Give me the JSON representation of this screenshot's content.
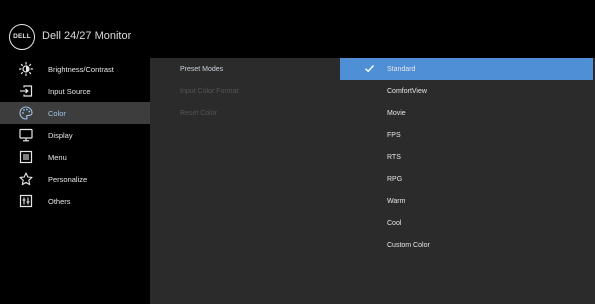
{
  "brand": {
    "logo_text": "DELL",
    "title": "Dell 24/27 Monitor"
  },
  "menu": {
    "items": [
      {
        "label": "Brightness/Contrast",
        "icon": "brightness-icon",
        "active": false
      },
      {
        "label": "Input Source",
        "icon": "input-source-icon",
        "active": false
      },
      {
        "label": "Color",
        "icon": "color-palette-icon",
        "active": true
      },
      {
        "label": "Display",
        "icon": "display-icon",
        "active": false
      },
      {
        "label": "Menu",
        "icon": "menu-icon",
        "active": false
      },
      {
        "label": "Personalize",
        "icon": "star-icon",
        "active": false
      },
      {
        "label": "Others",
        "icon": "others-icon",
        "active": false
      }
    ]
  },
  "submenu": {
    "items": [
      {
        "label": "Preset Modes",
        "active": true
      },
      {
        "label": "Input Color Format",
        "active": false
      },
      {
        "label": "Reset Color",
        "active": false
      }
    ]
  },
  "preset_modes": {
    "selected": "Standard",
    "options": [
      "Standard",
      "ComfortView",
      "Movie",
      "FPS",
      "RTS",
      "RPG",
      "Warm",
      "Cool",
      "Custom Color"
    ]
  },
  "colors": {
    "background": "#000000",
    "panel": "#2b2b2b",
    "active_menu": "#3d3d3d",
    "selection": "#4f8fd6"
  }
}
